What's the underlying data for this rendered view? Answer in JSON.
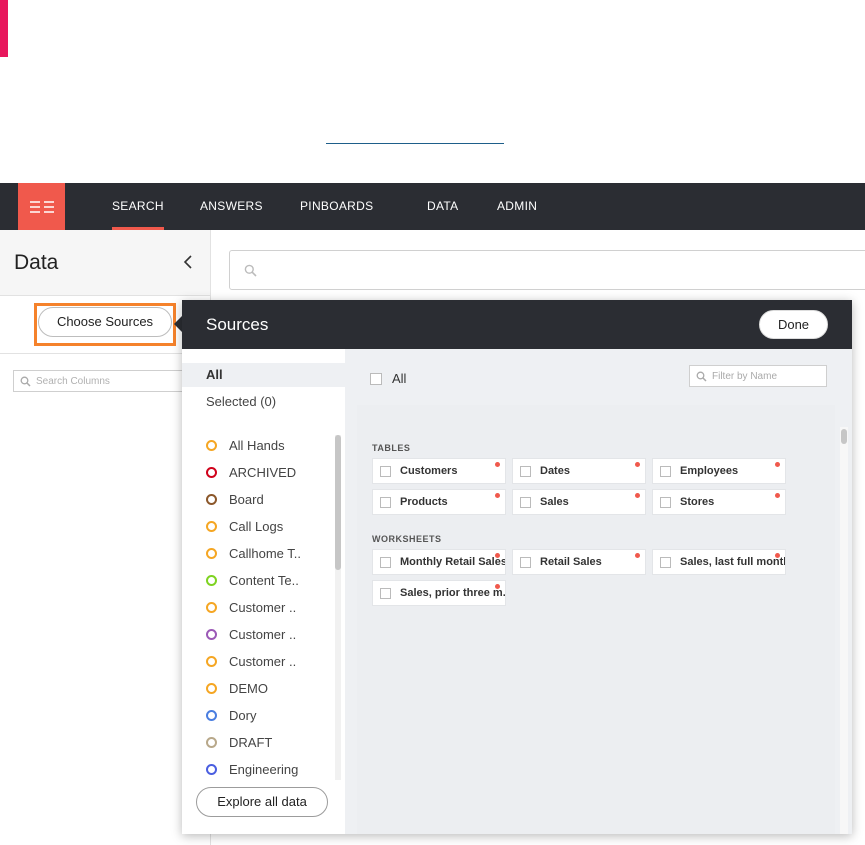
{
  "nav": {
    "items": [
      {
        "label": "SEARCH",
        "active": true
      },
      {
        "label": "ANSWERS",
        "active": false
      },
      {
        "label": "PINBOARDS",
        "active": false
      },
      {
        "label": "DATA",
        "active": false
      },
      {
        "label": "ADMIN",
        "active": false
      }
    ]
  },
  "data_panel": {
    "title": "Data",
    "choose_sources_label": "Choose Sources",
    "search_columns_placeholder": "Search Columns"
  },
  "main_search": {
    "placeholder": ""
  },
  "sources_dialog": {
    "title": "Sources",
    "done_label": "Done",
    "filters": {
      "all": "All",
      "selected": "Selected (0)"
    },
    "tags": [
      {
        "label": "All Hands",
        "color": "#f5a623"
      },
      {
        "label": "ARCHIVED",
        "color": "#d0021b"
      },
      {
        "label": "Board",
        "color": "#8b572a"
      },
      {
        "label": "Call Logs",
        "color": "#f5a623"
      },
      {
        "label": "Callhome T..",
        "color": "#f5a623"
      },
      {
        "label": "Content Te..",
        "color": "#7ed321"
      },
      {
        "label": "Customer ..",
        "color": "#f5a623"
      },
      {
        "label": "Customer ..",
        "color": "#9b59b6"
      },
      {
        "label": "Customer ..",
        "color": "#f5a623"
      },
      {
        "label": "DEMO",
        "color": "#f5a623"
      },
      {
        "label": "Dory",
        "color": "#4a7ee0"
      },
      {
        "label": "DRAFT",
        "color": "#b8a88a"
      },
      {
        "label": "Engineering",
        "color": "#4a5ee0"
      }
    ],
    "explore_label": "Explore all data",
    "all_checkbox_label": "All",
    "name_filter_placeholder": "Filter by Name",
    "tables_label": "TABLES",
    "tables": [
      "Customers",
      "Dates",
      "Employees",
      "Products",
      "Sales",
      "Stores"
    ],
    "worksheets_label": "WORKSHEETS",
    "worksheets": [
      "Monthly Retail Sales",
      "Retail Sales",
      "Sales, last full month",
      "Sales, prior three m.."
    ]
  },
  "colors": {
    "accent": "#f0594c",
    "nav_bg": "#2b2d33",
    "highlight": "#f5822b",
    "brand_pink": "#e8175d"
  }
}
